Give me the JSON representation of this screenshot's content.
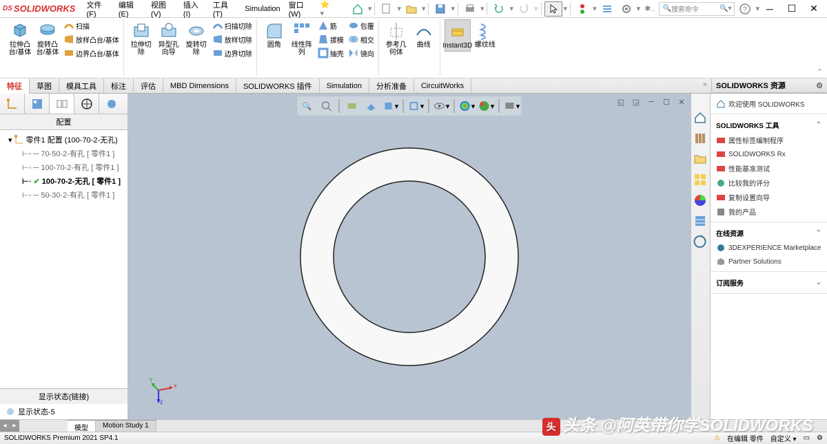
{
  "app": {
    "title": "SOLIDWORKS"
  },
  "menu": {
    "file": "文件(F)",
    "edit": "编辑(E)",
    "view": "视图(V)",
    "insert": "插入(I)",
    "tools": "工具(T)",
    "simulation": "Simulation",
    "window": "窗口(W)"
  },
  "search_placeholder": "搜索命令",
  "ribbon": {
    "extrude_boss": "拉伸凸台/基体",
    "revolve_boss": "旋转凸台/基体",
    "sweep": "扫描",
    "loft_boss": "放样凸台/基体",
    "boundary_boss": "边界凸台/基体",
    "extrude_cut": "拉伸切除",
    "hole_wizard": "异型孔向导",
    "revolve_cut": "旋转切除",
    "sweep_cut": "扫描切除",
    "loft_cut": "放样切除",
    "boundary_cut": "边界切除",
    "fillet": "圆角",
    "linear_pattern": "线性阵列",
    "rib": "筋",
    "wrap": "包覆",
    "draft": "拔模",
    "intersect": "相交",
    "shell": "抽壳",
    "mirror": "镜向",
    "ref_geom": "参考几何体",
    "curves": "曲线",
    "instant3d": "Instant3D",
    "thread": "螺纹线"
  },
  "tabs": {
    "feature": "特征",
    "sketch": "草图",
    "mold": "模具工具",
    "mark": "标注",
    "evaluate": "评估",
    "mbd": "MBD Dimensions",
    "addins": "SOLIDWORKS 插件",
    "simulation": "Simulation",
    "analysis": "分析准备",
    "circuit": "CircuitWorks"
  },
  "panel": {
    "header": "配置",
    "root": "零件1 配置  (100-70-2-无孔)",
    "configs": [
      "70-50-2-有孔 [ 零件1 ]",
      "100-70-2-有孔 [ 零件1 ]",
      "100-70-2-无孔 [ 零件1 ]",
      "50-30-2-有孔 [ 零件1 ]"
    ],
    "display_state_header": "显示状态(链接)",
    "display_state": "显示状态-5"
  },
  "right": {
    "title": "SOLIDWORKS 资源",
    "welcome": "欢迎使用 SOLIDWORKS",
    "tools_title": "SOLIDWORKS 工具",
    "tool1": "属性标签编制程序",
    "tool2": "SOLIDWORKS Rx",
    "tool3": "性能基准测试",
    "tool4": "比较我的评分",
    "tool5": "复制设置向导",
    "tool6": "我的产品",
    "online_title": "在线资源",
    "online1": "3DEXPERIENCE Marketplace",
    "online2": "Partner Solutions",
    "subscribe": "订阅服务"
  },
  "bottom_tabs": {
    "model": "模型",
    "motion": "Motion Study 1"
  },
  "status": {
    "left": "SOLIDWORKS Premium 2021 SP4.1",
    "editing": "在编辑  零件",
    "custom": "自定义"
  },
  "watermark": "头条 @阿英带你学SOLIDWORKS"
}
